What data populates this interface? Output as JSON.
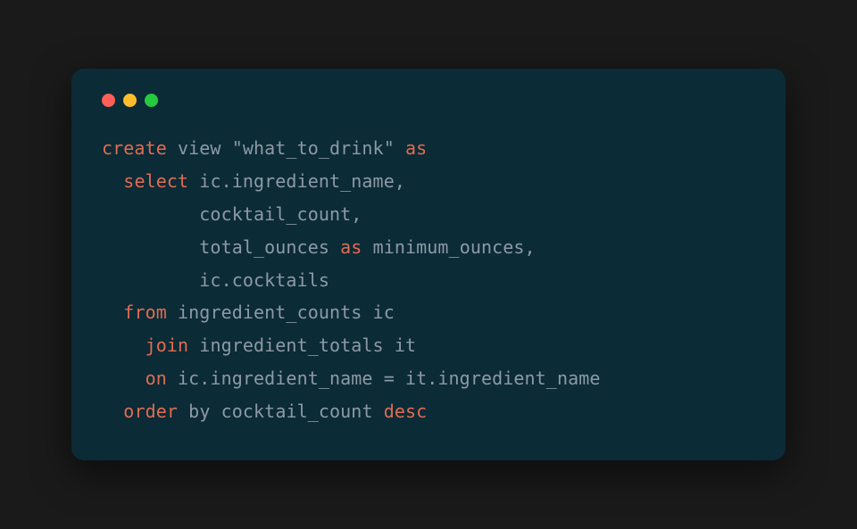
{
  "window": {
    "traffic_lights": [
      "red",
      "yellow",
      "green"
    ]
  },
  "code": {
    "lines": [
      {
        "indent": 0,
        "tokens": [
          {
            "cls": "kw",
            "text": "create"
          },
          {
            "cls": "id",
            "text": " view "
          },
          {
            "cls": "str",
            "text": "\"what_to_drink\""
          },
          {
            "cls": "id",
            "text": " "
          },
          {
            "cls": "kw",
            "text": "as"
          }
        ]
      },
      {
        "indent": 2,
        "tokens": [
          {
            "cls": "kw",
            "text": "select"
          },
          {
            "cls": "id",
            "text": " ic.ingredient_name,"
          }
        ]
      },
      {
        "indent": 9,
        "tokens": [
          {
            "cls": "id",
            "text": "cocktail_count,"
          }
        ]
      },
      {
        "indent": 9,
        "tokens": [
          {
            "cls": "id",
            "text": "total_ounces "
          },
          {
            "cls": "kw",
            "text": "as"
          },
          {
            "cls": "id",
            "text": " minimum_ounces,"
          }
        ]
      },
      {
        "indent": 9,
        "tokens": [
          {
            "cls": "id",
            "text": "ic.cocktails"
          }
        ]
      },
      {
        "indent": 2,
        "tokens": [
          {
            "cls": "kw",
            "text": "from"
          },
          {
            "cls": "id",
            "text": " ingredient_counts ic"
          }
        ]
      },
      {
        "indent": 4,
        "tokens": [
          {
            "cls": "kw",
            "text": "join"
          },
          {
            "cls": "id",
            "text": " ingredient_totals it"
          }
        ]
      },
      {
        "indent": 4,
        "tokens": [
          {
            "cls": "kw",
            "text": "on"
          },
          {
            "cls": "id",
            "text": " ic.ingredient_name = it.ingredient_name"
          }
        ]
      },
      {
        "indent": 2,
        "tokens": [
          {
            "cls": "kw",
            "text": "order"
          },
          {
            "cls": "id",
            "text": " "
          },
          {
            "cls": "kw2",
            "text": "by"
          },
          {
            "cls": "id",
            "text": " cocktail_count "
          },
          {
            "cls": "kw",
            "text": "desc"
          }
        ]
      }
    ]
  }
}
